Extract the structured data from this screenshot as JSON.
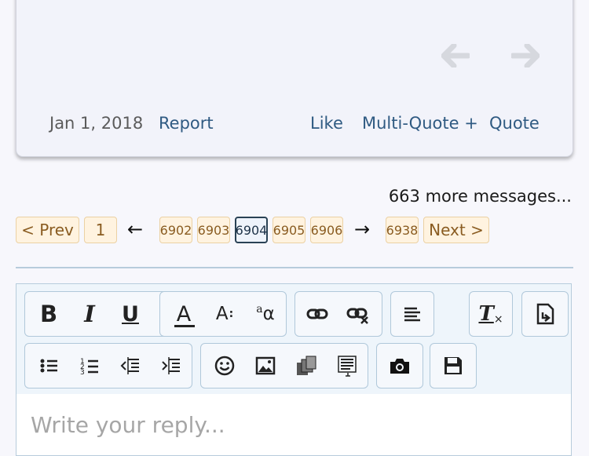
{
  "post": {
    "date": "Jan 1, 2018",
    "report": "Report",
    "like": "Like",
    "multi_quote": "Multi-Quote +",
    "quote": "Quote"
  },
  "pagination": {
    "more_messages": "663 more messages...",
    "prev": "< Prev",
    "first": "1",
    "left_arrow": "←",
    "pages": [
      "6902",
      "6903",
      "6904",
      "6905",
      "6906"
    ],
    "current": "6904",
    "right_arrow": "→",
    "last": "6938",
    "next": "Next >"
  },
  "editor": {
    "placeholder": "Write your reply...",
    "toolbar": {
      "bold": "B",
      "italic": "I",
      "underline": "U",
      "font_color": "A",
      "font_size": "A",
      "font_family": "a",
      "remove_format": "T"
    }
  },
  "colors": {
    "link": "#2f5a82",
    "page_bg": "#fff3e0",
    "page_border": "#ebd1a3",
    "current_border": "#2a4255"
  }
}
